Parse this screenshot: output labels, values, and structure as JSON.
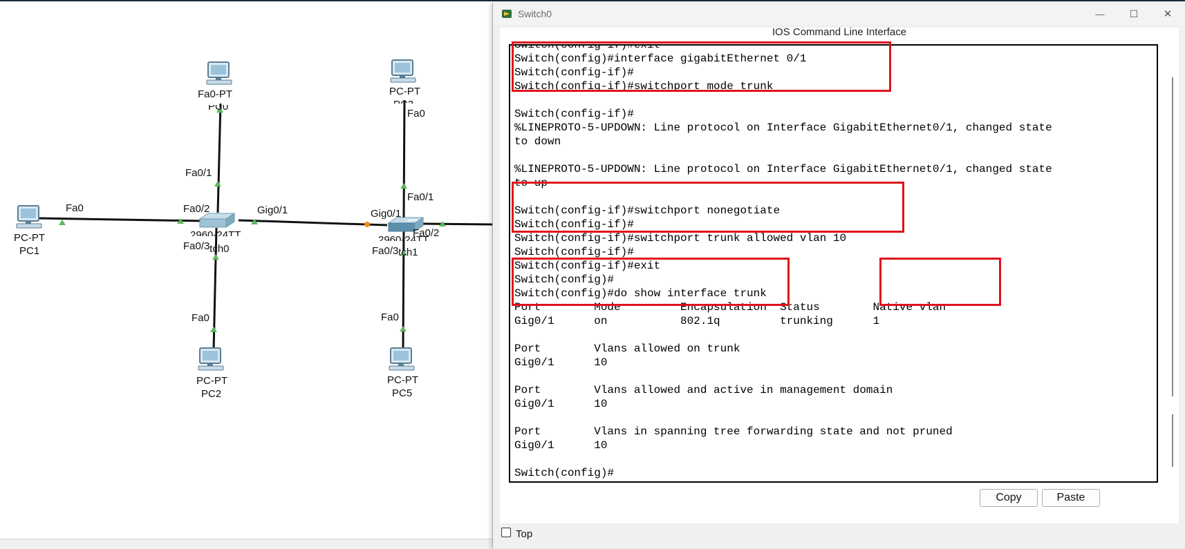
{
  "window": {
    "title": "Switch0",
    "heading": "IOS Command Line Interface",
    "minimize_glyph": "—",
    "maximize_glyph": "☐",
    "close_glyph": "✕"
  },
  "cli": {
    "text": "Switch(config-if)#exit\nSwitch(config)#interface gigabitEthernet 0/1\nSwitch(config-if)#\nSwitch(config-if)#switchport mode trunk\n\nSwitch(config-if)#\n%LINEPROTO-5-UPDOWN: Line protocol on Interface GigabitEthernet0/1, changed state\nto down\n\n%LINEPROTO-5-UPDOWN: Line protocol on Interface GigabitEthernet0/1, changed state\nto up\n\nSwitch(config-if)#switchport nonegotiate\nSwitch(config-if)#\nSwitch(config-if)#switchport trunk allowed vlan 10\nSwitch(config-if)#\nSwitch(config-if)#exit\nSwitch(config)#\nSwitch(config)#do show interface trunk\nPort        Mode         Encapsulation  Status        Native vlan\nGig0/1      on           802.1q         trunking      1\n\nPort        Vlans allowed on trunk\nGig0/1      10\n\nPort        Vlans allowed and active in management domain\nGig0/1      10\n\nPort        Vlans in spanning tree forwarding state and not pruned\nGig0/1      10\n\nSwitch(config)#"
  },
  "buttons": {
    "copy": "Copy",
    "paste": "Paste"
  },
  "top_checkbox": {
    "label": "Top",
    "checked": false
  },
  "highlight_color": "#e0121b",
  "topology": {
    "labels": {
      "pc0_port": "Fa0-PT",
      "pc0_name": "PC0",
      "pc0_link": "Fa0/1",
      "pc3_type": "PC-PT",
      "pc3_name": "PC3",
      "pc3_port": "Fa0",
      "pc3_link": "Fa0/1",
      "pc1_port": "Fa0",
      "pc1_type": "PC-PT",
      "pc1_name": "PC1",
      "sw0_fa02": "Fa0/2",
      "sw0_gig": "Gig0/1",
      "sw0_model": "2960-24TT",
      "sw0_fa03": "Fa0/3",
      "sw0_name": "Switch0",
      "pc2_port": "Fa0",
      "pc2_type": "PC-PT",
      "pc2_name": "PC2",
      "sw1_gig": "Gig0/1",
      "sw1_fa02": "Fa0/2",
      "sw1_model": "2960-24TT",
      "sw1_fa03": "Fa0/3",
      "sw1_name": "Switch1",
      "pc5_port": "Fa0",
      "pc5_type": "PC-PT",
      "pc5_name": "PC5"
    }
  }
}
